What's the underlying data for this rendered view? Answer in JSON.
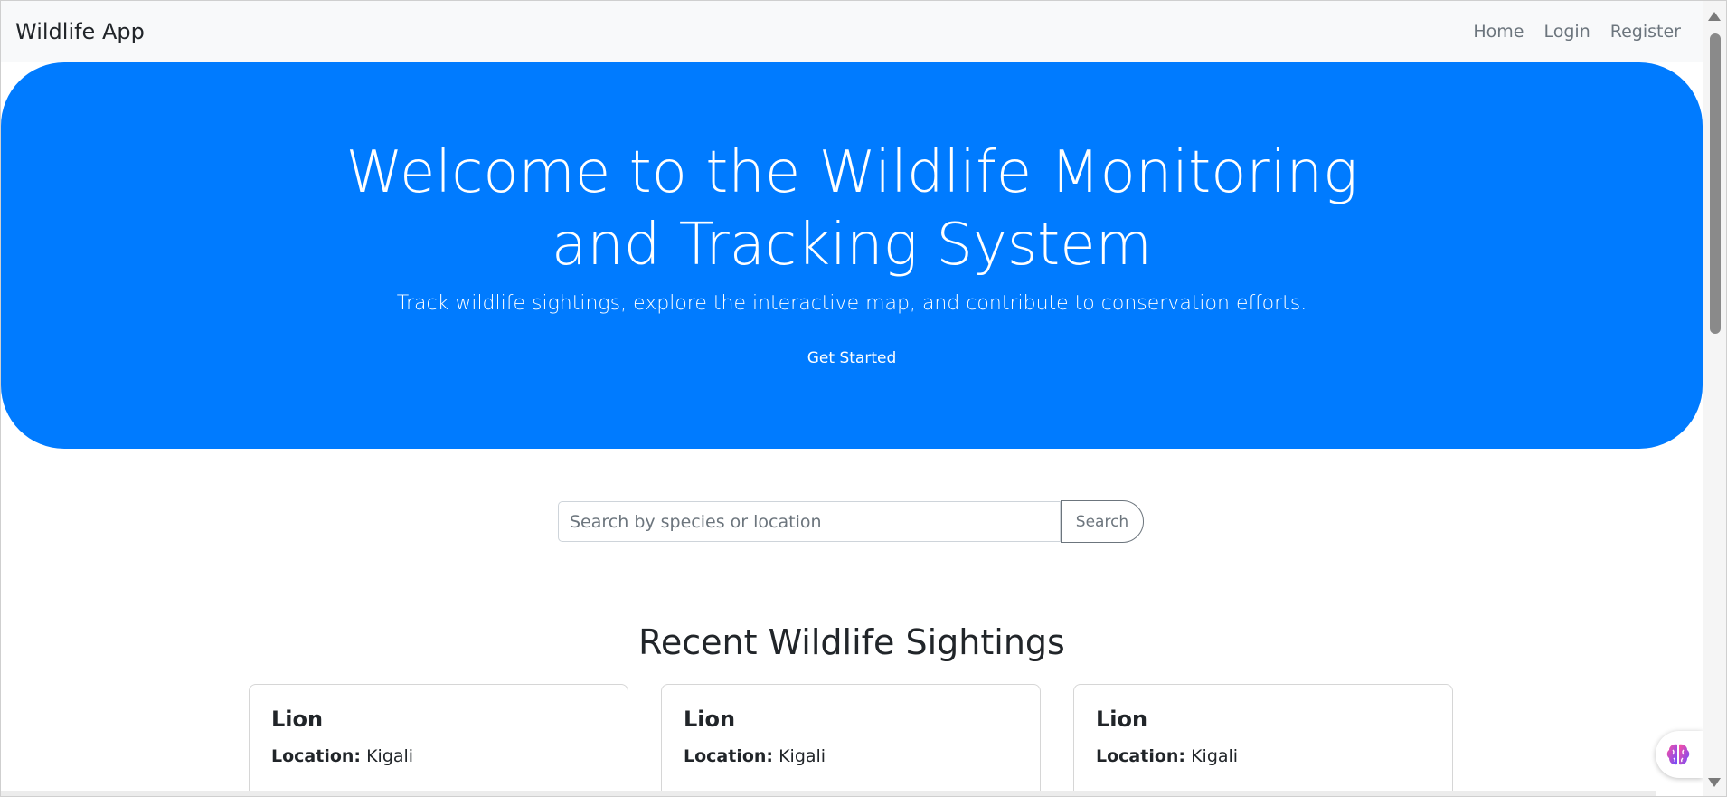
{
  "navbar": {
    "brand": "Wildlife App",
    "links": [
      "Home",
      "Login",
      "Register"
    ]
  },
  "hero": {
    "title": "Welcome to the Wildlife Monitoring and Tracking System",
    "subtitle": "Track wildlife sightings, explore the interactive map, and contribute to conservation efforts.",
    "cta": "Get Started",
    "bg_color": "#007bff"
  },
  "search": {
    "placeholder": "Search by species or location",
    "value": "",
    "button_label": "Search"
  },
  "section": {
    "title": "Recent Wildlife Sightings"
  },
  "cards": [
    {
      "species": "Lion",
      "location_label": "Location:",
      "location": "Kigali"
    },
    {
      "species": "Lion",
      "location_label": "Location:",
      "location": "Kigali"
    },
    {
      "species": "Lion",
      "location_label": "Location:",
      "location": "Kigali"
    }
  ],
  "widget": {
    "icon": "brain-icon"
  }
}
